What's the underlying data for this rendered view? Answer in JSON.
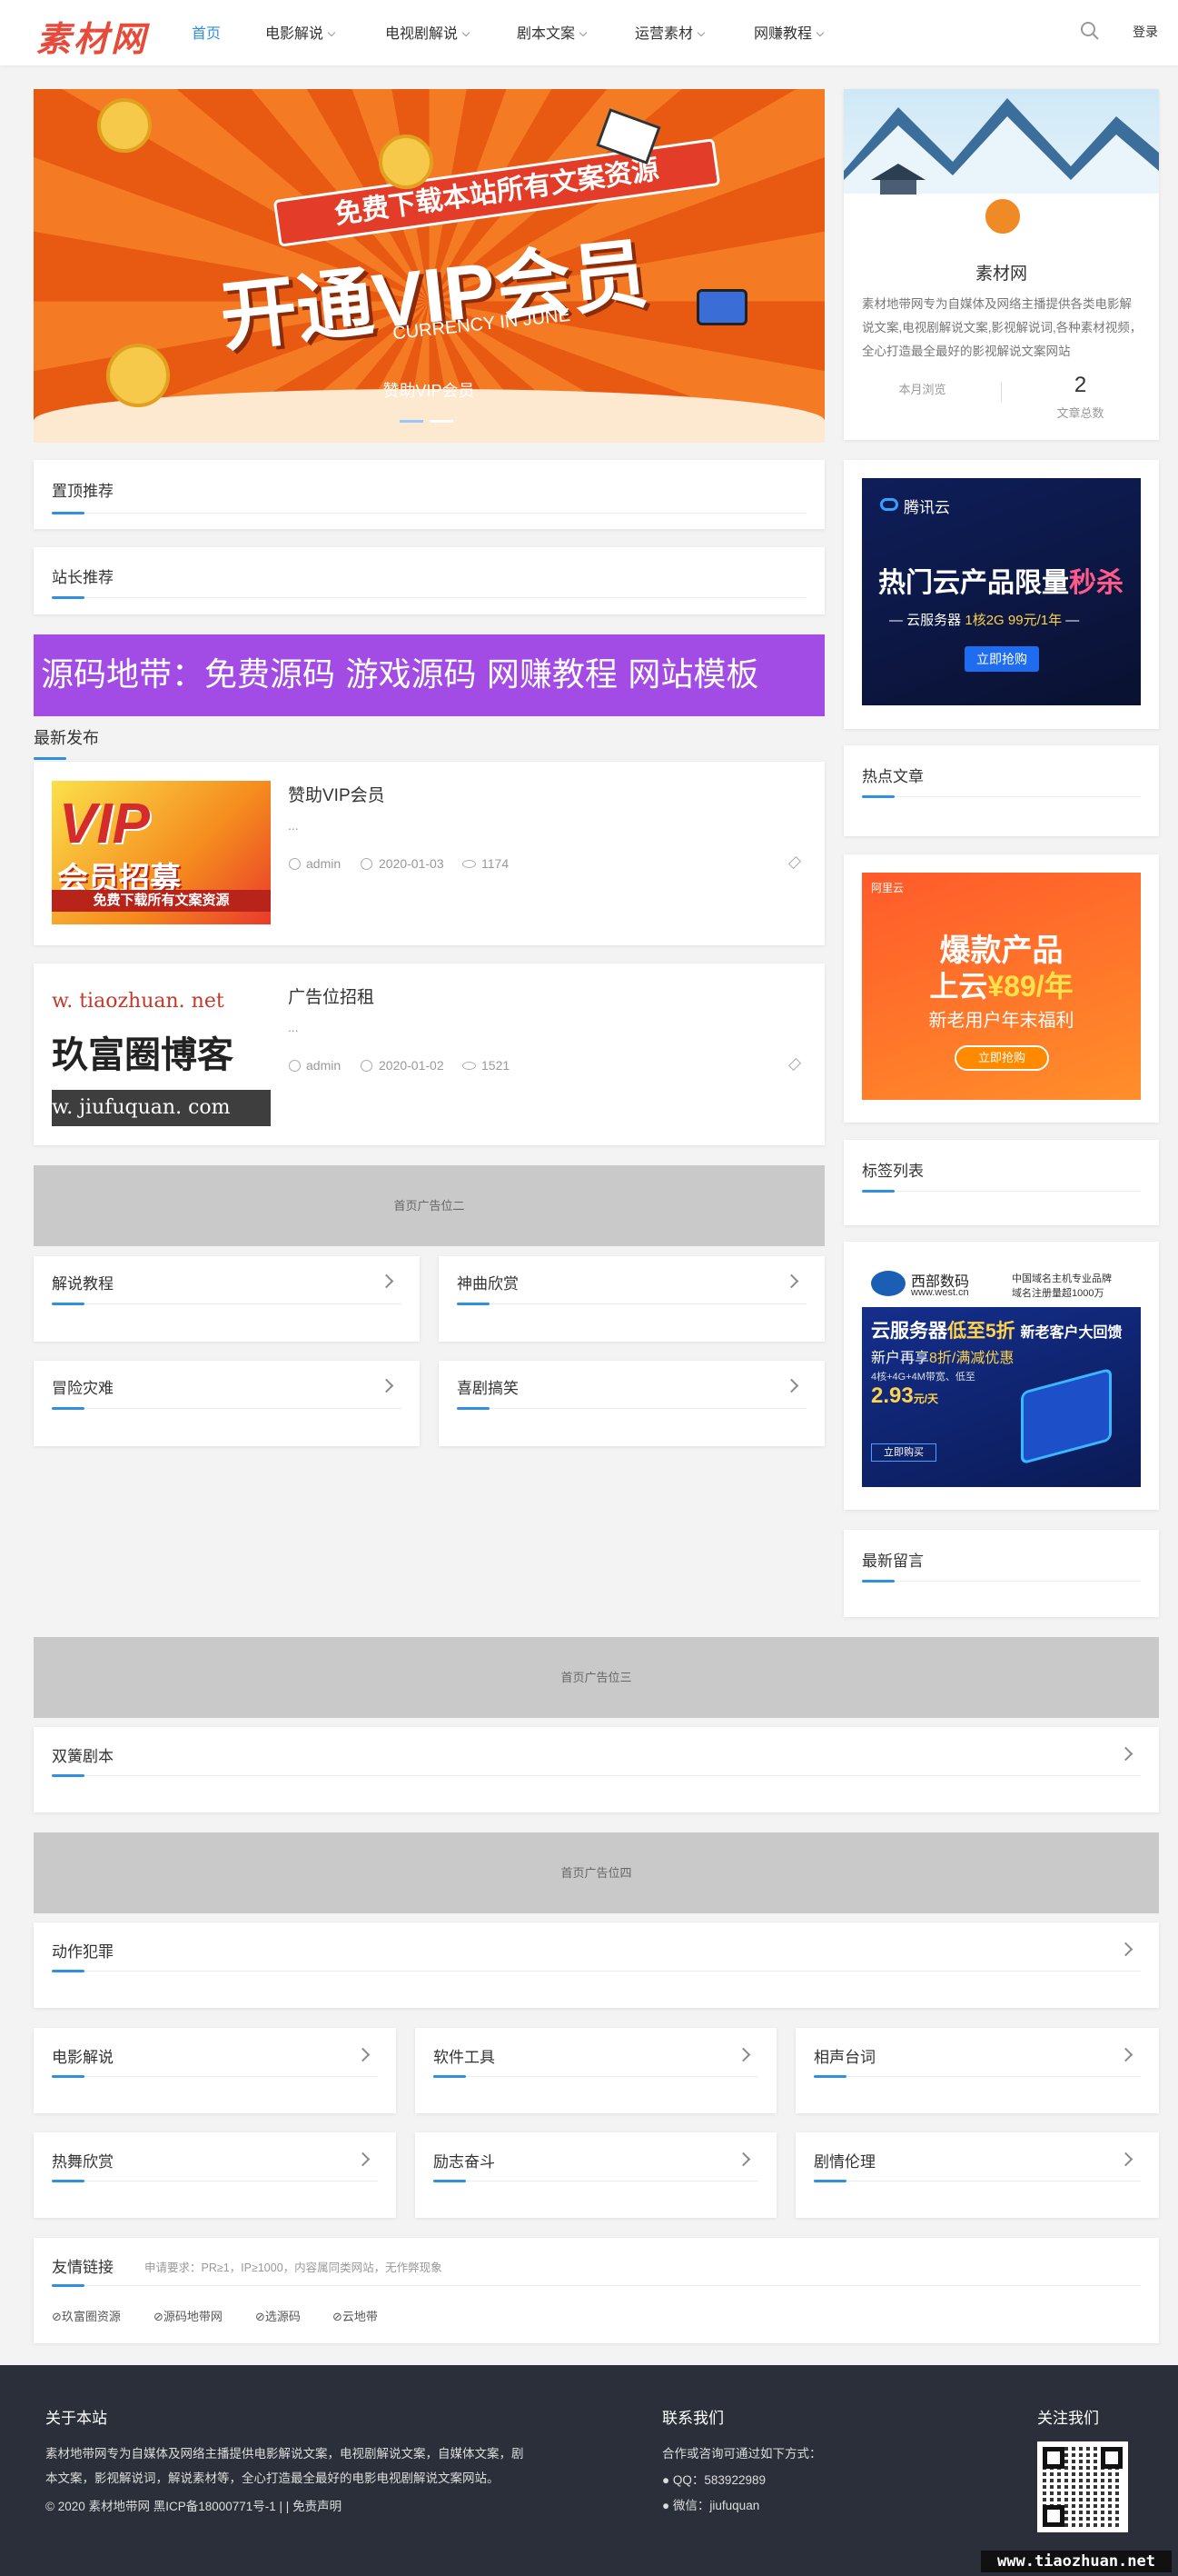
{
  "header": {
    "logo": "素材网",
    "nav": [
      {
        "label": "首页",
        "active": true
      },
      {
        "label": "电影解说"
      },
      {
        "label": "电视剧解说"
      },
      {
        "label": "剧本文案"
      },
      {
        "label": "运营素材"
      },
      {
        "label": "网赚教程"
      }
    ],
    "login": "登录",
    "search_icon": "search-icon"
  },
  "banner": {
    "headline_top": "免费下载本站所有文案资源",
    "headline_big": "开通VIP会员",
    "subline": "CURRENCY IN JUNE",
    "caption": "赞助VIP会员"
  },
  "sections": {
    "sticky": "置顶推荐",
    "admin_pick": "站长推荐",
    "purple_banner": "源码地带：免费源码 游戏源码 网赚教程 网站模板",
    "latest": "最新发布"
  },
  "posts": [
    {
      "title": "赞助VIP会员",
      "excerpt": "...",
      "author": "admin",
      "date": "2020-01-03",
      "views": "1174",
      "thumb": {
        "big": "VIP",
        "sub": "会员招募",
        "bar": "免费下载所有文案资源"
      }
    },
    {
      "title": "广告位招租",
      "excerpt": "...",
      "author": "admin",
      "date": "2020-01-02",
      "views": "1521",
      "thumb": {
        "line1": "w. tiaozhuan. net",
        "line2": "玖富圈博客",
        "line3": "w. jiufuquan. com"
      }
    }
  ],
  "ads": {
    "home2": "首页广告位二",
    "home3": "首页广告位三",
    "home4": "首页广告位四"
  },
  "category_grid_1": [
    "解说教程",
    "神曲欣赏",
    "冒险灾难",
    "喜剧搞笑"
  ],
  "wide_categories": [
    "双簧剧本",
    "动作犯罪"
  ],
  "category_grid_2": [
    "电影解说",
    "软件工具",
    "相声台词",
    "热舞欣赏",
    "励志奋斗",
    "剧情伦理"
  ],
  "profile": {
    "name": "素材网",
    "desc": "素材地带网专为自媒体及网络主播提供各类电影解说文案,电视剧解说文案,影视解说词,各种素材视频，全心打造最全最好的影视解说文案网站",
    "stat_label_1": "本月浏览",
    "stat_value_2": "2",
    "stat_label_2": "文章总数"
  },
  "sidebar": {
    "tencent": {
      "brand": "腾讯云",
      "headline": "热门云产品限量",
      "hot": "秒杀",
      "sub": "云服务器",
      "spec": "1核2G",
      "price": "99元/1年",
      "btn": "立即抢购"
    },
    "hot_articles": "热点文章",
    "aliyun": {
      "brand": "阿里云",
      "line1": "爆款产品",
      "line2a": "上云",
      "line2b": "¥89/年",
      "line3": "新老用户年末福利",
      "btn": "立即抢购"
    },
    "tags": "标签列表",
    "west": {
      "brand": "西部数码",
      "domain": "www.west.cn",
      "slogan1": "中国域名主机专业品牌",
      "slogan2": "域名注册量超1000万",
      "headline_a": "云服务器",
      "headline_b": "低至5折",
      "headline_c": "新老客户大回馈",
      "line2a": "新户再享",
      "line2b": "8折/满减优惠",
      "spec": "4核+4G+4M带宽、低至",
      "price": "2.93",
      "unit": "元/天",
      "btn": "立即购买"
    },
    "latest_comments": "最新留言"
  },
  "friend_links": {
    "title": "友情链接",
    "note": "申请要求：PR≥1，IP≥1000，内容属同类网站，无作弊现象",
    "links": [
      "玖富圈资源",
      "源码地带网",
      "选源码",
      "云地带"
    ]
  },
  "footer": {
    "about_title": "关于本站",
    "about_text_1": "素材地带网专为自媒体及网络主播提供电影解说文案，电视剧解说文案，自媒体文案，剧",
    "about_text_2": "本文案，影视解说词，解说素材等，全心打造最全最好的电影电视剧解说文案网站。",
    "copyright": "© 2020 素材地带网   黑ICP备18000771号-1 | | 免责声明",
    "contact_title": "联系我们",
    "contact_intro": "合作或咨询可通过如下方式：",
    "qq": "QQ：583922989",
    "wechat": "微信：jiufuquan",
    "follow_title": "关注我们",
    "watermark": "www.tiaozhuan.net"
  }
}
